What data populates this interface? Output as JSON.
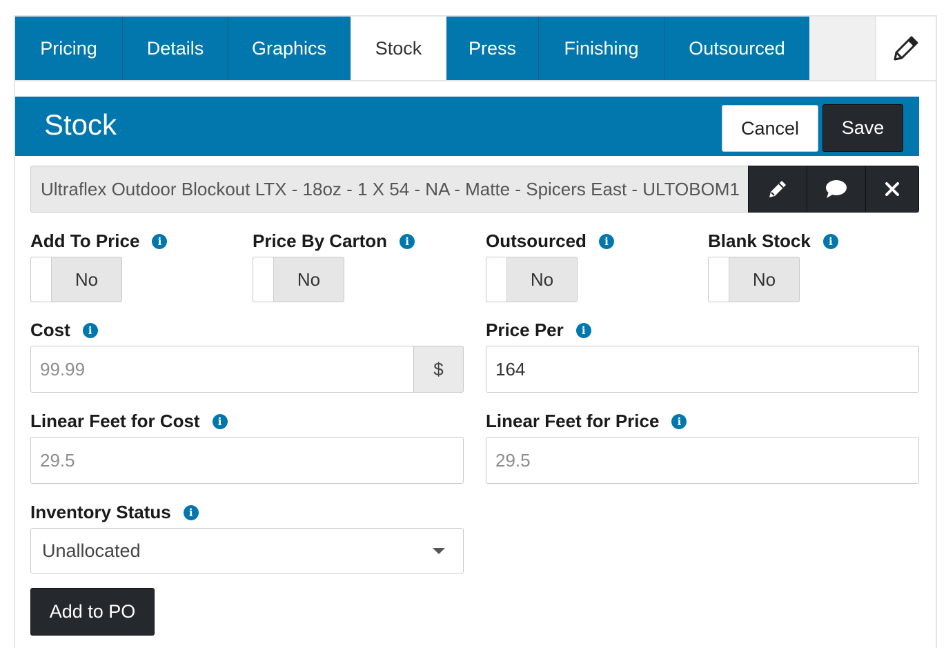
{
  "tabs": [
    {
      "label": "Pricing"
    },
    {
      "label": "Details"
    },
    {
      "label": "Graphics"
    },
    {
      "label": "Stock"
    },
    {
      "label": "Press"
    },
    {
      "label": "Finishing"
    },
    {
      "label": "Outsourced"
    }
  ],
  "active_tab": "Stock",
  "header": {
    "title": "Stock",
    "cancel_label": "Cancel",
    "save_label": "Save"
  },
  "stock": {
    "selected": "Ultraflex Outdoor Blockout LTX - 18oz - 1 X 54 - NA - Matte - Spicers East - ULTOBOM1"
  },
  "toggles": {
    "add_to_price": {
      "label": "Add To Price",
      "value": "No"
    },
    "price_by_carton": {
      "label": "Price By Carton",
      "value": "No"
    },
    "outsourced": {
      "label": "Outsourced",
      "value": "No"
    },
    "blank_stock": {
      "label": "Blank Stock",
      "value": "No"
    }
  },
  "fields": {
    "cost": {
      "label": "Cost",
      "placeholder": "99.99",
      "addon": "$"
    },
    "price_per": {
      "label": "Price Per",
      "value": "164"
    },
    "linear_feet_cost": {
      "label": "Linear Feet for Cost",
      "placeholder": "29.5"
    },
    "linear_feet_price": {
      "label": "Linear Feet for Price",
      "placeholder": "29.5"
    },
    "inventory_status": {
      "label": "Inventory Status",
      "value": "Unallocated"
    }
  },
  "info_glyph": "i",
  "add_po_label": "Add to PO",
  "colors": {
    "primary": "#0277ad",
    "dark_button": "#25292e",
    "tab_bar_bg": "#f0f0f0"
  }
}
